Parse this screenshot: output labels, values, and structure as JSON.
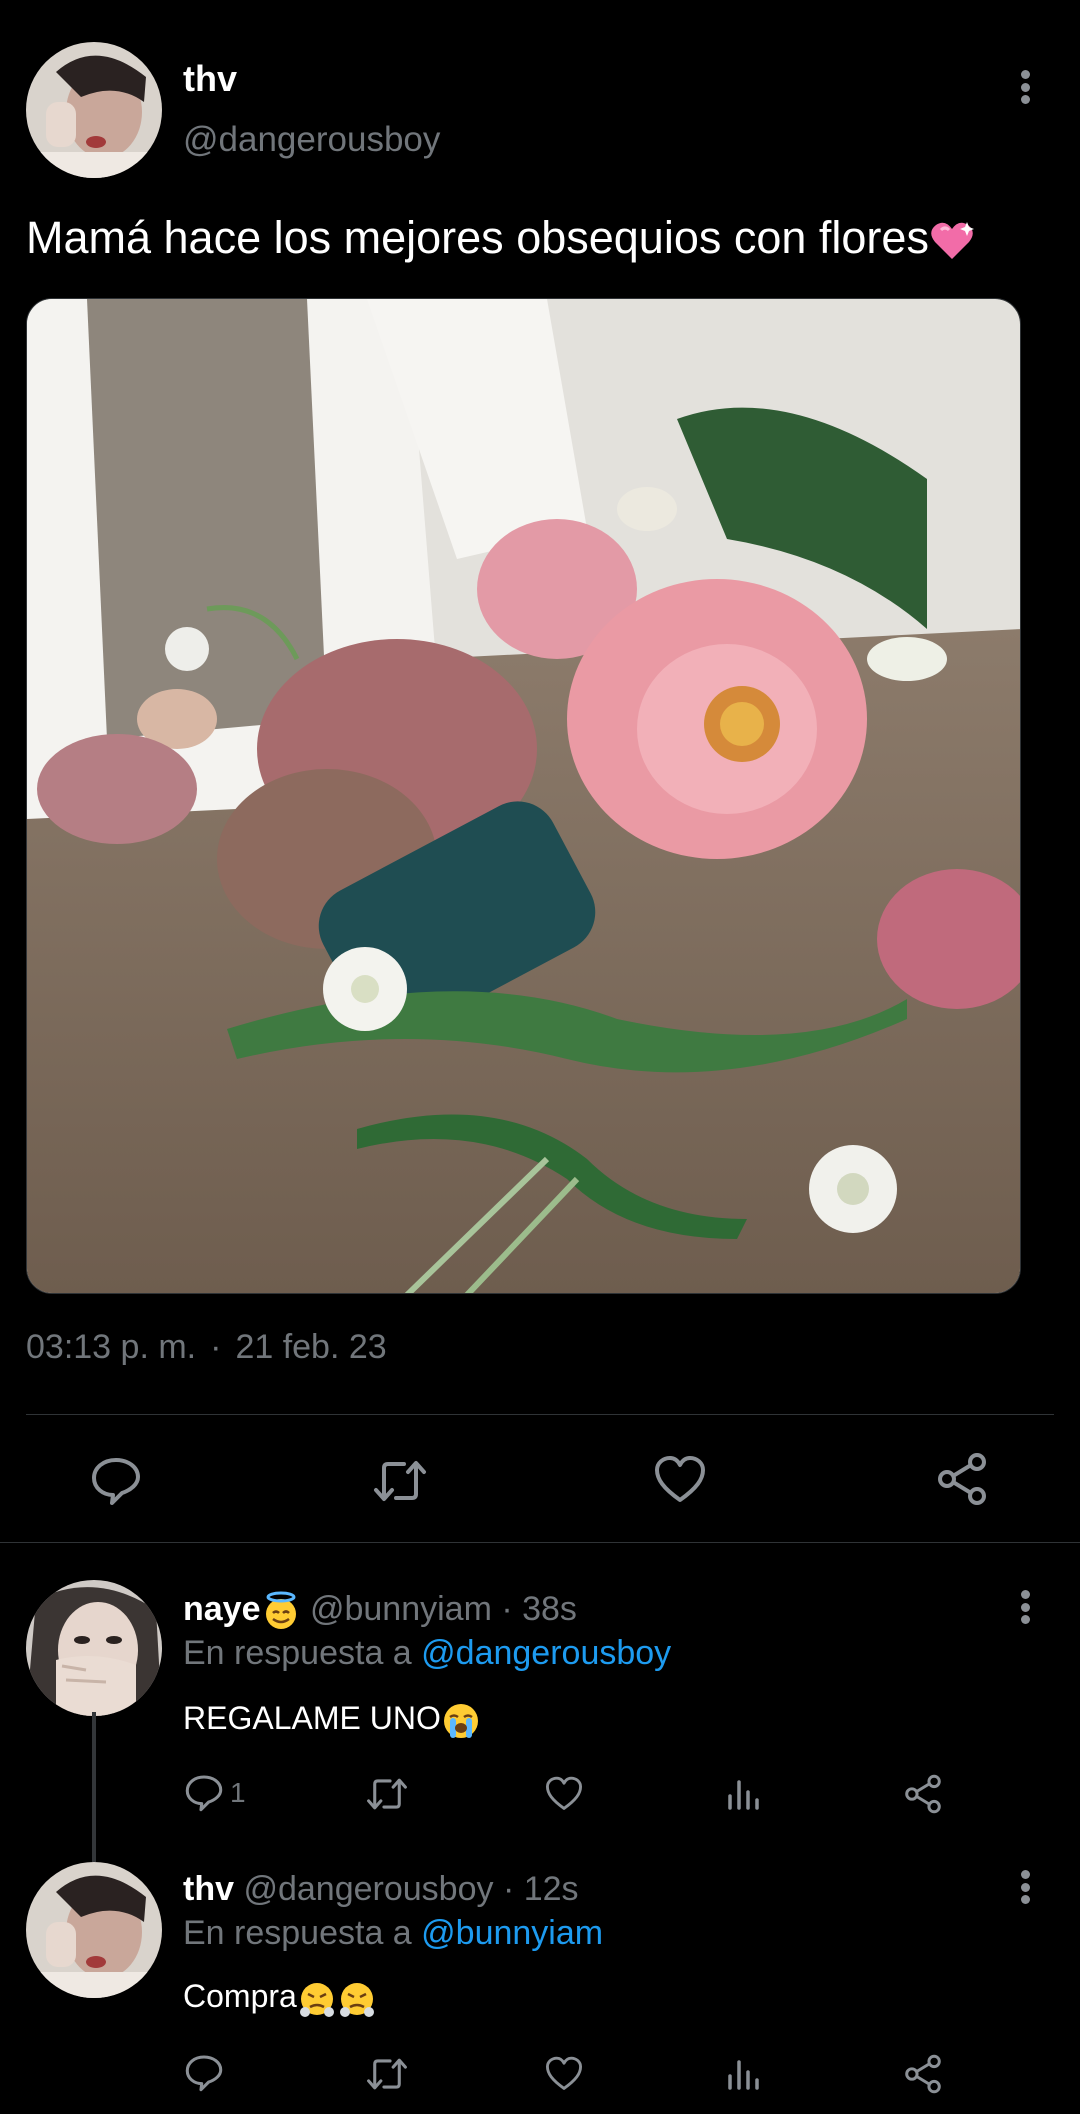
{
  "main_tweet": {
    "display_name": "thv",
    "handle": "@dangerousboy",
    "text": "Mamá hace los mejores obsequios con flores",
    "text_emoji": "pink-heart-emoji",
    "time": "03:13 p. m.",
    "separator": "·",
    "date": "21 feb. 23"
  },
  "replies": [
    {
      "display_name": "naye",
      "name_emoji": "smiling-face-with-halo-emoji",
      "handle": "@bunnyiam",
      "time": "· 38s",
      "reply_prefix": "En respuesta a",
      "reply_to": "@dangerousboy",
      "text": "REGALAME UNO",
      "text_emoji": "loudly-crying-face-emoji",
      "reply_count": "1"
    },
    {
      "display_name": "thv",
      "handle": "@dangerousboy",
      "time": "· 12s",
      "reply_prefix": "En respuesta a",
      "reply_to": "@bunnyiam",
      "text": "Compra",
      "text_emoji": "face-with-steam-from-nose-emoji"
    }
  ],
  "icons": {
    "reply": "reply-icon",
    "retweet": "retweet-icon",
    "like": "like-icon",
    "views": "views-icon",
    "share": "share-icon",
    "more": "more-icon"
  },
  "colors": {
    "background": "#000000",
    "text_primary": "#e7e9ea",
    "text_secondary": "#71767b",
    "link": "#1d9bf0",
    "divider": "#2f3336"
  }
}
